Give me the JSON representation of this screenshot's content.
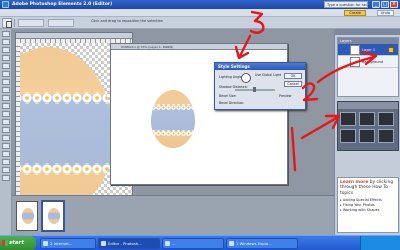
{
  "window": {
    "title": "Adobe Photoshop Elements 2.0 (Editor)",
    "help_search": "Type a question for help",
    "minimize": "_",
    "maximize": "□",
    "close": "×"
  },
  "menu": {
    "items": [
      "File",
      "Edit",
      "Image",
      "Enhance",
      "Layer",
      "Select",
      "Filter",
      "View",
      "Window",
      "Help"
    ],
    "create_label": "Create",
    "undo_label": "Undo"
  },
  "options": {
    "hint": "Click and drag to reposition the selection"
  },
  "documents": {
    "doc2_title": "Untitled-1 @ 33% (Layer 1, RGB/8)"
  },
  "style_dialog": {
    "title": "Style Settings",
    "lighting_angle_label": "Lighting Angle:",
    "use_global_light": "Use Global Light",
    "shadow_distance_label": "Shadow Distance:",
    "bevel_size_label": "Bevel Size:",
    "bevel_direction_label": "Bevel Direction:",
    "ok": "OK",
    "cancel": "Cancel",
    "preview": "Preview"
  },
  "layers_panel": {
    "header": "Layers",
    "rows": [
      "Layer 1",
      "Background"
    ]
  },
  "effects_panel": {
    "header": "Styles and Effects"
  },
  "learn_more": {
    "lead": "Learn more",
    "text": "by clicking through these How To topics",
    "topics": [
      "Adding Special Effects",
      "Fixing Your Photos",
      "Working with Shapes"
    ]
  },
  "taskbar": {
    "start": "start",
    "tasks": [
      "2 Internet...",
      "Editor - Photosh...",
      "...",
      "1 Windows Explo..."
    ],
    "clock": ""
  },
  "annotations": {
    "labels": [
      "1",
      "2",
      "3"
    ],
    "color": "#e8161a"
  }
}
